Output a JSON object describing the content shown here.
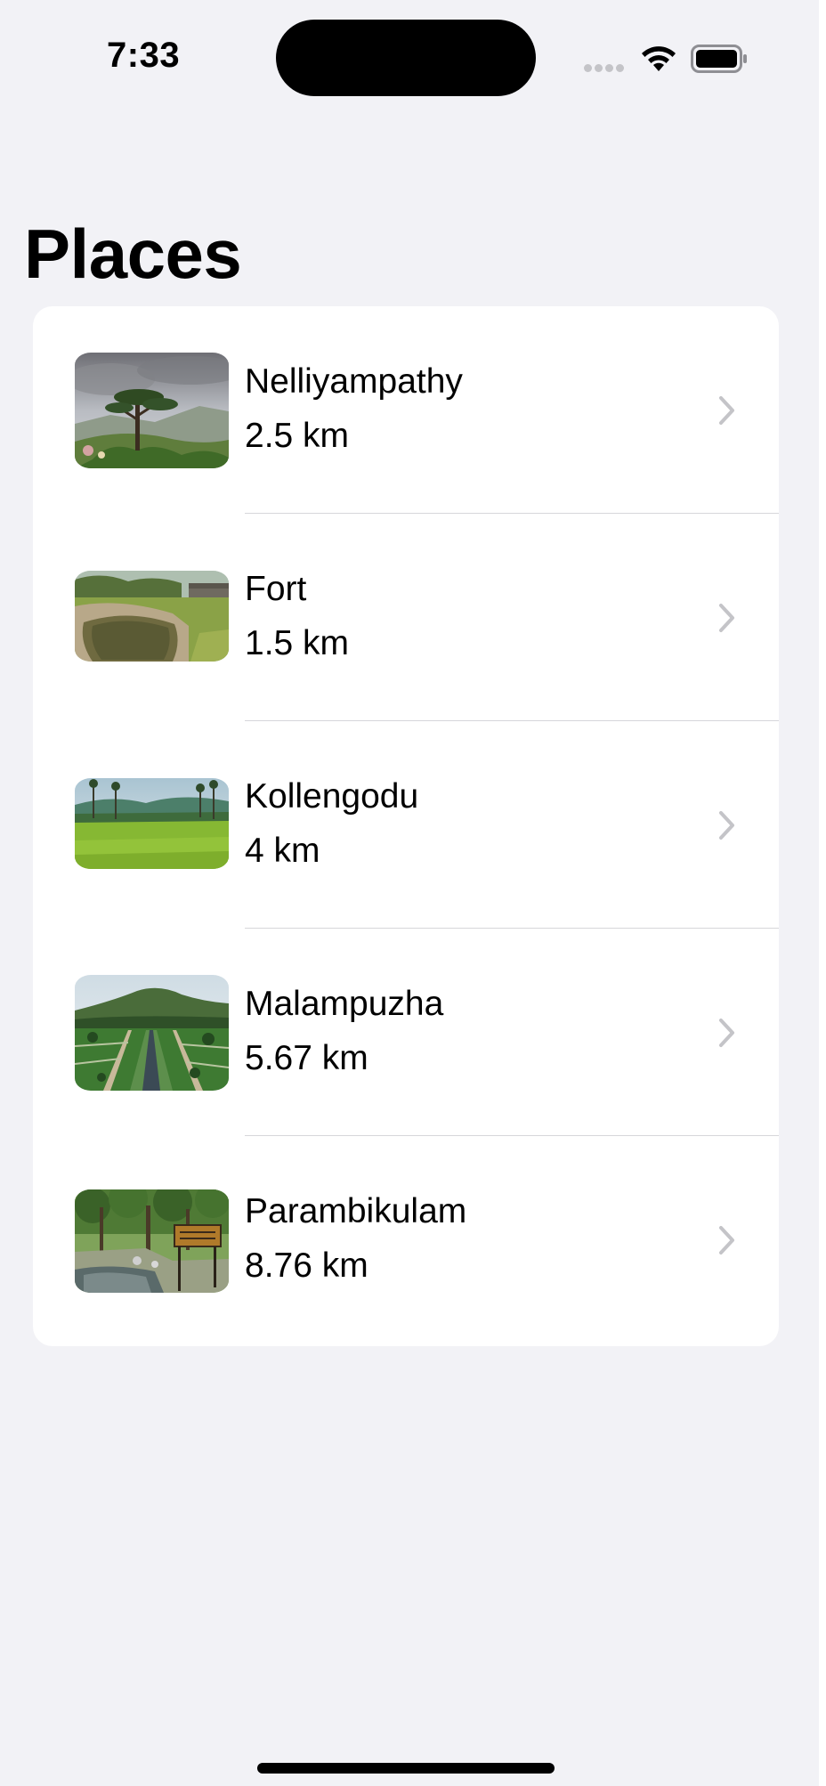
{
  "status_bar": {
    "time": "7:33",
    "signal_icon": "cellular-signal-icon",
    "wifi_icon": "wifi-icon",
    "battery_icon": "battery-icon"
  },
  "title": "Places",
  "places": [
    {
      "name": "Nelliyampathy",
      "distance": "2.5 km",
      "image": "nelliyampathy-photo"
    },
    {
      "name": "Fort",
      "distance": "1.5 km",
      "image": "fort-photo"
    },
    {
      "name": "Kollengodu",
      "distance": "4 km",
      "image": "kollengodu-photo"
    },
    {
      "name": "Malampuzha",
      "distance": "5.67 km",
      "image": "malampuzha-photo"
    },
    {
      "name": "Parambikulam",
      "distance": "8.76 km",
      "image": "parambikulam-photo"
    }
  ],
  "colors": {
    "background": "#f2f2f6",
    "card": "#ffffff",
    "chevron": "#c4c4c8",
    "separator": "#d6d6da"
  }
}
